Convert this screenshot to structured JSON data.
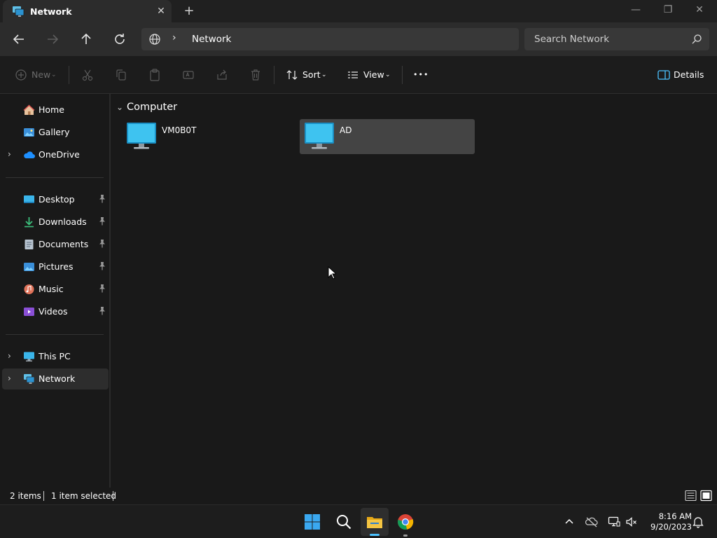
{
  "tab": {
    "title": "Network",
    "close": "✕",
    "new_tab": "+"
  },
  "window_controls": {
    "minimize": "—",
    "maximize": "❐",
    "close": "✕"
  },
  "address": {
    "location": "Network",
    "separator": "›"
  },
  "search": {
    "placeholder": "Search Network"
  },
  "command_bar": {
    "new_label": "New",
    "sort_label": "Sort",
    "view_label": "View",
    "more_label": "•••",
    "details_label": "Details"
  },
  "sidebar": {
    "quick": [
      {
        "label": "Home",
        "icon": "home-icon"
      },
      {
        "label": "Gallery",
        "icon": "gallery-icon"
      },
      {
        "label": "OneDrive",
        "icon": "onedrive-icon",
        "expandable": true
      }
    ],
    "pinned": [
      {
        "label": "Desktop",
        "icon": "desktop-icon"
      },
      {
        "label": "Downloads",
        "icon": "downloads-icon"
      },
      {
        "label": "Documents",
        "icon": "documents-icon"
      },
      {
        "label": "Pictures",
        "icon": "pictures-icon"
      },
      {
        "label": "Music",
        "icon": "music-icon"
      },
      {
        "label": "Videos",
        "icon": "videos-icon"
      }
    ],
    "locations": [
      {
        "label": "This PC",
        "icon": "this-pc-icon"
      },
      {
        "label": "Network",
        "icon": "network-icon",
        "selected": true
      }
    ]
  },
  "content": {
    "group_title": "Computer",
    "items": [
      {
        "name": "VM0B0T",
        "selected": false
      },
      {
        "name": "AD",
        "selected": true
      }
    ]
  },
  "status": {
    "item_count": "2 items",
    "selection": "1 item selected"
  },
  "taskbar": {
    "apps": [
      "start-icon",
      "search-icon",
      "file-explorer-icon",
      "chrome-icon"
    ],
    "time": "8:16 AM",
    "date": "9/20/2023"
  },
  "colors": {
    "background": "#191919",
    "selection": "#444444",
    "accent": "#4cc2ff",
    "folder_yellow": "#f5c542"
  }
}
